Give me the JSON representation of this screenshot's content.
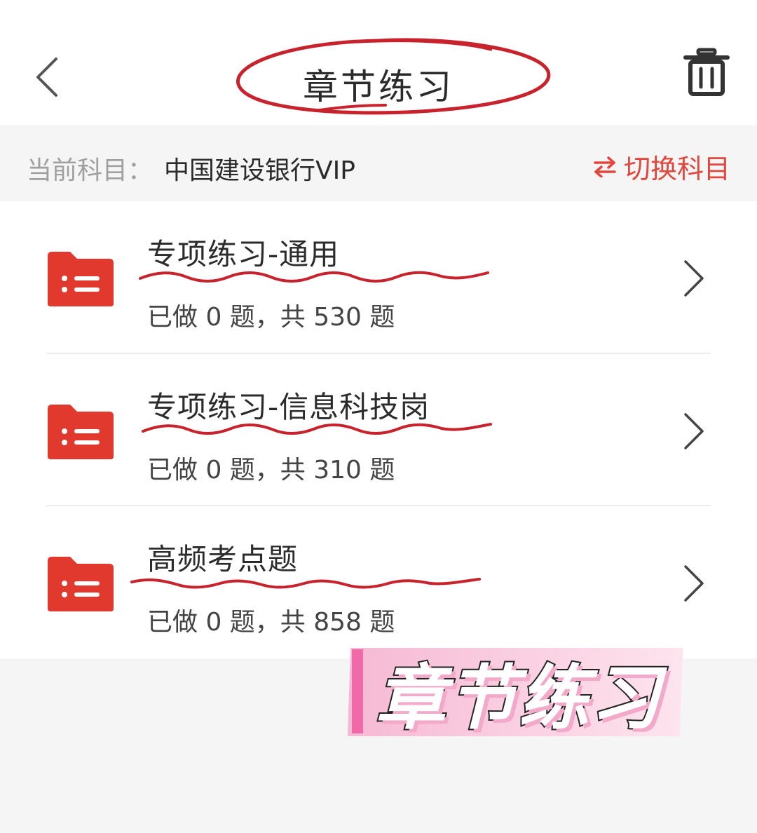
{
  "header": {
    "title": "章节练习",
    "back_icon": "chevron-left-icon",
    "trash_icon": "trash-icon"
  },
  "subject": {
    "label": "当前科目：",
    "name": "中国建设银行VIP",
    "switch_label": "切换科目",
    "switch_icon": "swap-arrows-icon"
  },
  "items": [
    {
      "title": "专项练习-通用",
      "progress": "已做 0 题，共 530 题",
      "done": 0,
      "total": 530
    },
    {
      "title": "专项练习-信息科技岗",
      "progress": "已做 0 题，共 310 题",
      "done": 0,
      "total": 310
    },
    {
      "title": "高频考点题",
      "progress": "已做 0 题，共 858 题",
      "done": 0,
      "total": 858
    }
  ],
  "sticker": {
    "text": "章节练习"
  },
  "colors": {
    "accent": "#e2473d",
    "folder": "#e2392f",
    "annotation": "#c8232c",
    "sticker_pink": "#f6b9d4"
  }
}
